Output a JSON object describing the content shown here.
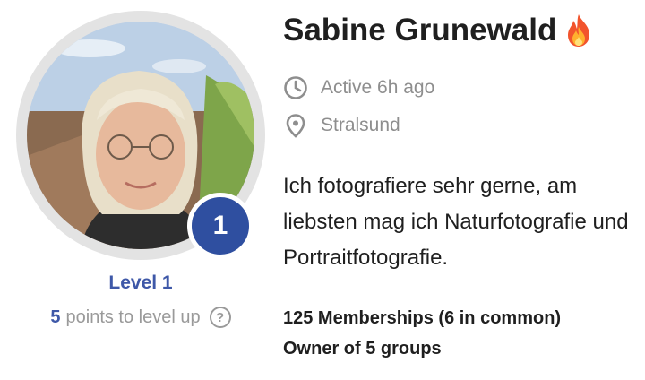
{
  "profile": {
    "name": "Sabine Grunewald",
    "name_icon": "fire-icon",
    "active_status": "Active 6h ago",
    "location": "Stralsund",
    "bio": "Ich fotografiere sehr gerne, am liebsten mag ich Naturfotografie und Portraitfotografie.",
    "memberships": "125 Memberships (6 in common)",
    "owned_groups": "Owner of 5 groups"
  },
  "level": {
    "badge_number": "1",
    "label": "Level 1",
    "points": "5",
    "points_suffix": "points to level up",
    "help_glyph": "?"
  },
  "colors": {
    "accent": "#3e58a8",
    "badge": "#2f4fa0",
    "muted": "#8e8e8e",
    "text": "#1f1f1f",
    "ring": "#e3e3e3"
  }
}
